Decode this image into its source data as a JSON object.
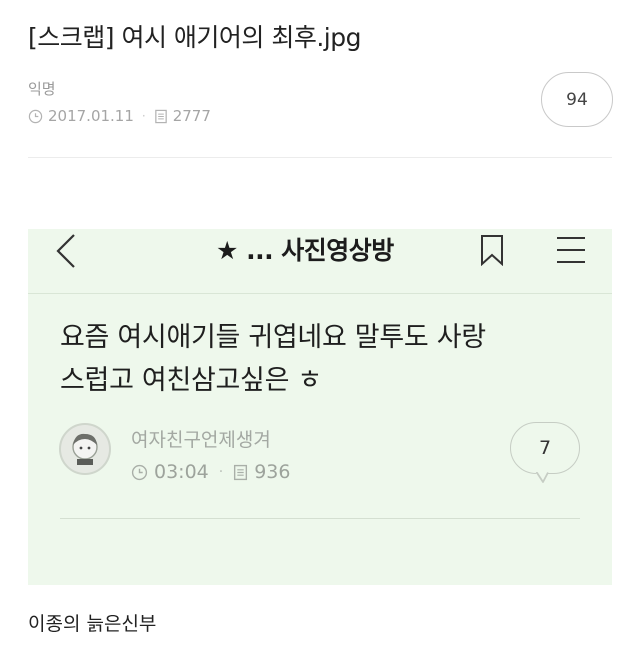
{
  "post": {
    "title": "[스크랩] 여시 애기어의 최후.jpg",
    "author": "익명",
    "date": "2017.01.11",
    "views": "2777",
    "comment_count": "94",
    "icons": {
      "clock": "clock-icon",
      "views": "document-icon"
    }
  },
  "embedded": {
    "header": {
      "board_title": "★ ... 사진영상방",
      "back_icon": "chevron-left-icon",
      "bookmark_icon": "bookmark-icon",
      "menu_icon": "hamburger-menu-icon"
    },
    "body_lines": [
      "요즘 여시애기들 귀엽네요 말투도 사랑",
      "스럽고 여친삼고싶은 ㅎ"
    ],
    "author": "여자친구언제생겨",
    "time": "03:04",
    "views": "936",
    "comment_count": "7",
    "background": "#eef8ec"
  },
  "caption": "이종의 늙은신부"
}
